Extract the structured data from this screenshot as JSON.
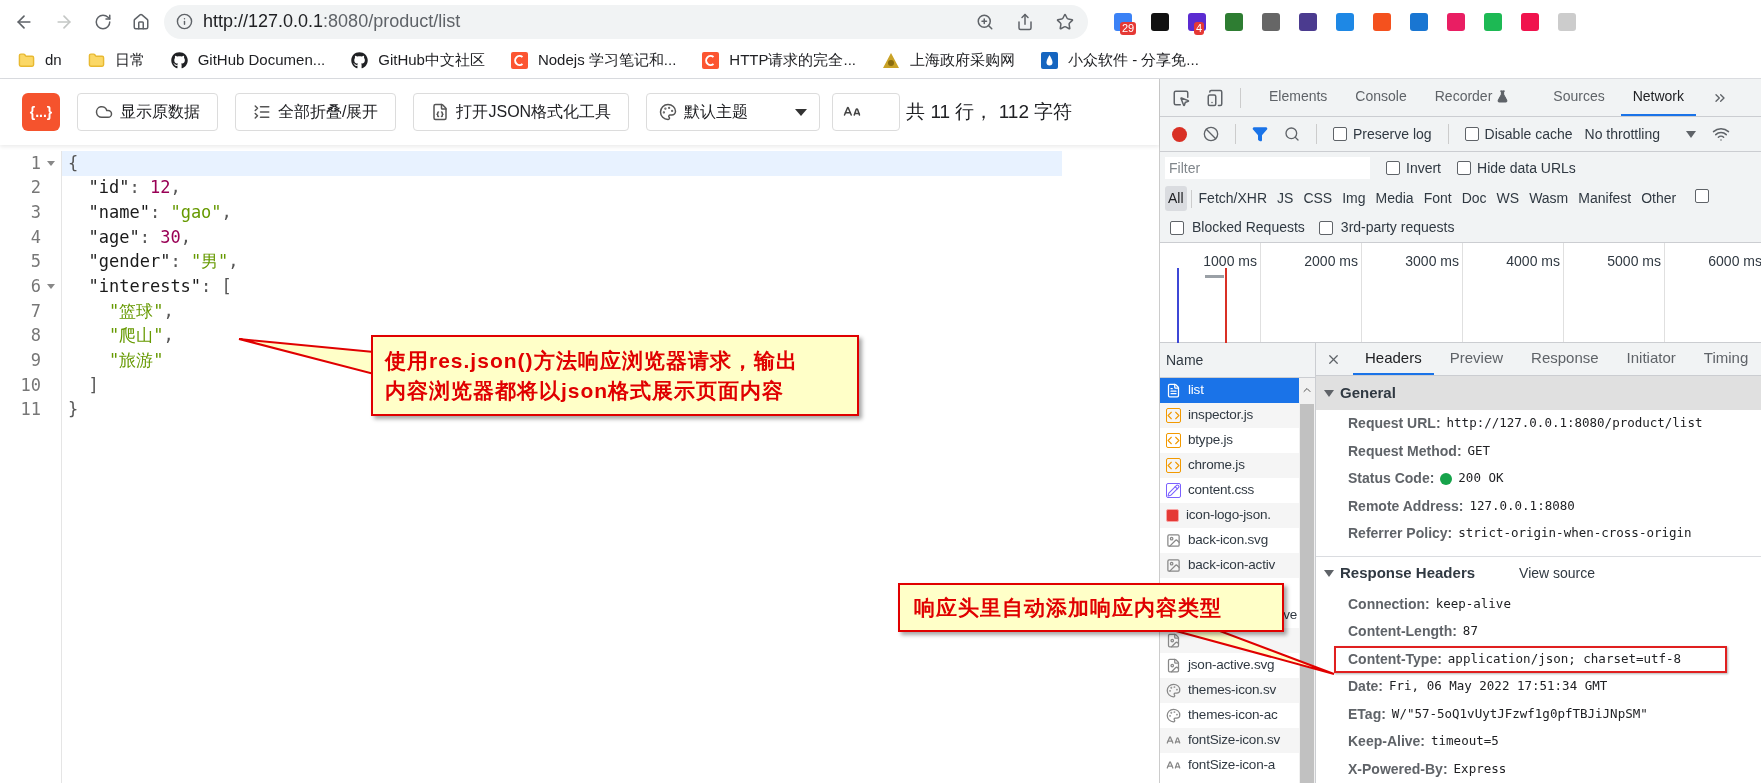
{
  "browser": {
    "url_host": "http://127.0.0.1",
    "url_path": ":8080/product/list",
    "extensions": [
      {
        "color": "#3b82f6",
        "badge": "29"
      },
      {
        "color": "#111111"
      },
      {
        "color": "#5b2bd1",
        "badge": "4"
      },
      {
        "color": "#2e7d32"
      },
      {
        "color": "#666666"
      },
      {
        "color": "#4b3b8f"
      },
      {
        "color": "#1e88e5"
      },
      {
        "color": "#f4511e"
      },
      {
        "color": "#1976d2"
      },
      {
        "color": "#e91e63"
      },
      {
        "color": "#1db954"
      },
      {
        "color": "#f0134d"
      },
      {
        "color": "#cccccc"
      }
    ],
    "bookmarks": [
      {
        "kind": "folder",
        "label": "dn"
      },
      {
        "kind": "folder",
        "label": "日常"
      },
      {
        "kind": "github",
        "label": "GitHub Documen..."
      },
      {
        "kind": "github",
        "label": "GitHub中文社区"
      },
      {
        "kind": "csdn",
        "label": "Nodejs 学习笔记和..."
      },
      {
        "kind": "csdn",
        "label": "HTTP请求的完全..."
      },
      {
        "kind": "emblem",
        "label": "上海政府采购网"
      },
      {
        "kind": "drop",
        "label": "小众软件 - 分享免..."
      }
    ]
  },
  "viewer": {
    "logo": "{...}",
    "buttons": [
      {
        "kind": "cloud",
        "label": "显示原数据"
      },
      {
        "kind": "fold",
        "label": "全部折叠/展开"
      },
      {
        "kind": "json",
        "label": "打开JSON格式化工具"
      }
    ],
    "theme": "默认主题",
    "stats": "共 11 行， 112 字符"
  },
  "code": [
    {
      "number": "1",
      "foldable": true,
      "selected": true,
      "tokens": [
        {
          "kind": "punct",
          "text": "{"
        }
      ],
      "children": [
        {
          "number": "2",
          "foldable": false,
          "selected": false,
          "tokens": [
            {
              "kind": "key",
              "text": "\"id\""
            },
            {
              "kind": "punct",
              "text": ": "
            },
            {
              "kind": "number",
              "text": "12"
            },
            {
              "kind": "punct",
              "text": ","
            }
          ]
        },
        {
          "number": "3",
          "foldable": false,
          "selected": false,
          "tokens": [
            {
              "kind": "key",
              "text": "\"name\""
            },
            {
              "kind": "punct",
              "text": ": "
            },
            {
              "kind": "string",
              "text": "\"gao\""
            },
            {
              "kind": "punct",
              "text": ","
            }
          ]
        },
        {
          "number": "4",
          "foldable": false,
          "selected": false,
          "tokens": [
            {
              "kind": "key",
              "text": "\"age\""
            },
            {
              "kind": "punct",
              "text": ": "
            },
            {
              "kind": "number",
              "text": "30"
            },
            {
              "kind": "punct",
              "text": ","
            }
          ]
        },
        {
          "number": "5",
          "foldable": false,
          "selected": false,
          "tokens": [
            {
              "kind": "key",
              "text": "\"gender\""
            },
            {
              "kind": "punct",
              "text": ": "
            },
            {
              "kind": "string",
              "text": "\"男\""
            },
            {
              "kind": "punct",
              "text": ","
            }
          ]
        },
        {
          "number": "6",
          "foldable": true,
          "selected": false,
          "tokens": [
            {
              "kind": "key",
              "text": "\"interests\""
            },
            {
              "kind": "punct",
              "text": ": ["
            }
          ],
          "children": [
            {
              "number": "7",
              "foldable": false,
              "selected": false,
              "tokens": [
                {
                  "kind": "string",
                  "text": "\"篮球\""
                },
                {
                  "kind": "punct",
                  "text": ","
                }
              ]
            },
            {
              "number": "8",
              "foldable": false,
              "selected": false,
              "tokens": [
                {
                  "kind": "string",
                  "text": "\"爬山\""
                },
                {
                  "kind": "punct",
                  "text": ","
                }
              ]
            },
            {
              "number": "9",
              "foldable": false,
              "selected": false,
              "tokens": [
                {
                  "kind": "string",
                  "text": "\"旅游\""
                }
              ]
            }
          ]
        },
        {
          "number": "10",
          "foldable": false,
          "selected": false,
          "tokens": [
            {
              "kind": "punct",
              "text": "]"
            }
          ]
        }
      ]
    },
    {
      "number": "11",
      "foldable": false,
      "selected": false,
      "tokens": [
        {
          "kind": "punct",
          "text": "}"
        }
      ]
    }
  ],
  "devtools": {
    "panel_tabs": [
      {
        "label": "Elements",
        "selected": false
      },
      {
        "label": "Console",
        "selected": false
      },
      {
        "label": "Recorder",
        "selected": false,
        "experimental": true
      },
      {
        "label": "Sources",
        "selected": false
      },
      {
        "label": "Network",
        "selected": true
      }
    ],
    "preserve_log": {
      "label": "Preserve log",
      "checked": false
    },
    "disable_cache": {
      "label": "Disable cache",
      "checked": false
    },
    "throttling": "No throttling",
    "filter": {
      "placeholder": "Filter"
    },
    "invert": {
      "label": "Invert",
      "checked": false
    },
    "hide_data_urls": {
      "label": "Hide data URLs",
      "checked": false
    },
    "types": [
      {
        "label": "All",
        "selected": true
      },
      {
        "label": "Fetch/XHR",
        "selected": false
      },
      {
        "label": "JS",
        "selected": false
      },
      {
        "label": "CSS",
        "selected": false
      },
      {
        "label": "Img",
        "selected": false
      },
      {
        "label": "Media",
        "selected": false
      },
      {
        "label": "Font",
        "selected": false
      },
      {
        "label": "Doc",
        "selected": false
      },
      {
        "label": "WS",
        "selected": false
      },
      {
        "label": "Wasm",
        "selected": false
      },
      {
        "label": "Manifest",
        "selected": false
      },
      {
        "label": "Other",
        "selected": false
      }
    ],
    "types_checkbox": {
      "checked": false
    },
    "blocked": {
      "label": "Blocked Requests",
      "checked": false
    },
    "third_party": {
      "label": "3rd-party requests",
      "checked": false
    },
    "timeline": {
      "ticks": [
        "1000 ms",
        "2000 ms",
        "3000 ms",
        "4000 ms",
        "5000 ms",
        "6000 ms"
      ]
    },
    "files_header": "Name",
    "files": [
      {
        "kind": "doc",
        "name": "list",
        "selected": true
      },
      {
        "kind": "js",
        "name": "inspector.js",
        "selected": false
      },
      {
        "kind": "js",
        "name": "btype.js",
        "selected": false
      },
      {
        "kind": "js",
        "name": "chrome.js",
        "selected": false
      },
      {
        "kind": "css",
        "name": "content.css",
        "selected": false
      },
      {
        "kind": "img",
        "name": "icon-logo-json.",
        "selected": false
      },
      {
        "kind": "svg",
        "name": "back-icon.svg",
        "selected": false
      },
      {
        "kind": "svg",
        "name": "back-icon-activ",
        "selected": false
      },
      {
        "kind": "hidden",
        "name": "ve",
        "selected": false
      },
      {
        "kind": "file",
        "selected": false
      },
      {
        "kind": "file",
        "name": "json-active.svg",
        "selected": false
      },
      {
        "kind": "theme",
        "name": "themes-icon.sv",
        "selected": false
      },
      {
        "kind": "theme",
        "name": "themes-icon-ac",
        "selected": false
      },
      {
        "kind": "font",
        "name": "fontSize-icon.sv",
        "selected": false
      },
      {
        "kind": "font",
        "name": "fontSize-icon-a",
        "selected": false
      }
    ],
    "detail_tabs": [
      {
        "label": "Headers",
        "selected": true
      },
      {
        "label": "Preview",
        "selected": false
      },
      {
        "label": "Response",
        "selected": false
      },
      {
        "label": "Initiator",
        "selected": false
      },
      {
        "label": "Timing",
        "selected": false
      }
    ],
    "sections": [
      {
        "title": "General",
        "expanded": true,
        "rows": [
          {
            "label": "Request URL:",
            "value": "http://127.0.0.1:8080/product/list",
            "highlighted": false
          },
          {
            "label": "Request Method:",
            "value": "GET",
            "highlighted": false
          },
          {
            "label": "Status Code:",
            "value": "200 OK",
            "color": "#16a34a",
            "highlighted": false
          },
          {
            "label": "Remote Address:",
            "value": "127.0.0.1:8080",
            "highlighted": false
          },
          {
            "label": "Referrer Policy:",
            "value": "strict-origin-when-cross-origin",
            "highlighted": false
          }
        ]
      },
      {
        "title": "Response Headers",
        "expanded": true,
        "link": "View source",
        "rows": [
          {
            "label": "Connection:",
            "value": "keep-alive",
            "highlighted": false
          },
          {
            "label": "Content-Length:",
            "value": "87",
            "highlighted": false
          },
          {
            "label": "Content-Type:",
            "value": "application/json; charset=utf-8",
            "highlighted": true
          },
          {
            "label": "Date:",
            "value": "Fri, 06 May 2022 17:51:34 GMT",
            "highlighted": false
          },
          {
            "label": "ETag:",
            "value": "W/\"57-5oQ1vUytJFzwf1g0pfTBJiJNpSM\"",
            "highlighted": false
          },
          {
            "label": "Keep-Alive:",
            "value": "timeout=5",
            "highlighted": false
          },
          {
            "label": "X-Powered-By:",
            "value": "Express",
            "highlighted": false
          }
        ]
      }
    ]
  },
  "callouts": [
    {
      "text": "使用res.json()方法响应浏览器请求，输出内容浏览器都将以json格式展示页面内容"
    },
    {
      "text": "响应头里自动添加响应内容类型"
    }
  ]
}
